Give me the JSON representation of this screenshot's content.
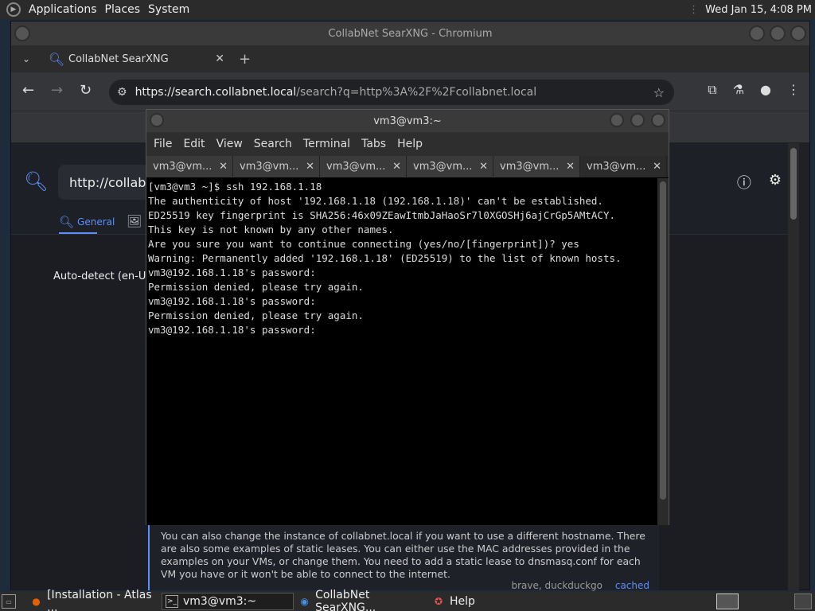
{
  "topbar": {
    "menus": [
      "Applications",
      "Places",
      "System"
    ],
    "clock": "Wed Jan 15,  4:08 PM"
  },
  "browser": {
    "window_title": "CollabNet SearXNG - Chromium",
    "tab_title": "CollabNet SearXNG",
    "url_host": "https://search.collabnet.local",
    "url_path": "/search?q=http%3A%2F%2Fcollabnet.local",
    "page": {
      "search_value": "http://collabne",
      "category_general": "General",
      "language": "Auto-detect (en-US)",
      "answer_text": "You can also change the instance of collabnet.local if you want to use a different hostname. There are also some examples of static leases. You can either use the MAC addresses provided in the examples on your VMs, or change them. You need to add a static lease to dnsmasq.conf for each VM you have or it won't be able to connect to the internet.",
      "answer_engines": "brave, duckduckgo",
      "answer_cached": "cached"
    }
  },
  "terminal": {
    "title": "vm3@vm3:~",
    "menu": [
      "File",
      "Edit",
      "View",
      "Search",
      "Terminal",
      "Tabs",
      "Help"
    ],
    "tabs": [
      "vm3@vm...",
      "vm3@vm...",
      "vm3@vm...",
      "vm3@vm...",
      "vm3@vm...",
      "vm3@vm..."
    ],
    "active_tab": 5,
    "output": "[vm3@vm3 ~]$ ssh 192.168.1.18\nThe authenticity of host '192.168.1.18 (192.168.1.18)' can't be established.\nED25519 key fingerprint is SHA256:46x09ZEawItmbJaHaoSr7l0XGOSHj6ajCrGp5AMtACY.\nThis key is not known by any other names.\nAre you sure you want to continue connecting (yes/no/[fingerprint])? yes\nWarning: Permanently added '192.168.1.18' (ED25519) to the list of known hosts.\nvm3@192.168.1.18's password:\nPermission denied, please try again.\nvm3@192.168.1.18's password:\nPermission denied, please try again.\nvm3@192.168.1.18's password:"
  },
  "taskbar": {
    "items": [
      "[Installation - Atlas ...",
      "vm3@vm3:~",
      "CollabNet SearXNG...",
      "Help"
    ]
  },
  "colors": {
    "accent": "#5b8ff9",
    "terminal_bg": "#000000",
    "panel_bg": "#2b2b2b"
  }
}
